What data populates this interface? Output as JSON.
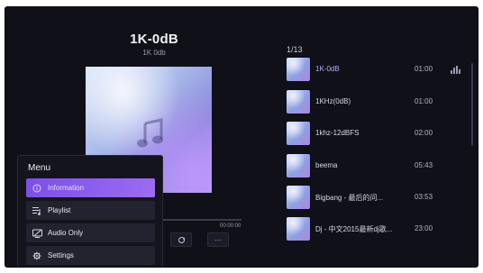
{
  "now_playing": {
    "title": "1K-0dB",
    "subtitle": "1K 0db",
    "time": "00:00:00"
  },
  "controls": {
    "buttons": [
      {
        "icon": "repeat-icon"
      },
      {
        "icon": "more-icon",
        "label": "···"
      }
    ]
  },
  "playlist": {
    "counter": "1/13",
    "tracks": [
      {
        "name": "1K-0dB",
        "time": "01:00",
        "playing": true
      },
      {
        "name": "1KHz(0dB)",
        "time": "01:00"
      },
      {
        "name": "1khz-12dBFS",
        "time": "02:00"
      },
      {
        "name": "beema",
        "time": "05:43"
      },
      {
        "name": "Bigbang - 最后的问...",
        "time": "03:53"
      },
      {
        "name": "Dj - 中文2015最新dj歌...",
        "time": "23:00"
      }
    ]
  },
  "menu": {
    "title": "Menu",
    "items": [
      {
        "label": "Information",
        "icon": "info-icon",
        "selected": true
      },
      {
        "label": "Playlist",
        "icon": "playlist-icon"
      },
      {
        "label": "Audio Only",
        "icon": "audio-only-icon"
      },
      {
        "label": "Settings",
        "icon": "settings-icon"
      }
    ]
  },
  "colors": {
    "accent": "#8a5cf0",
    "background": "#101018"
  }
}
